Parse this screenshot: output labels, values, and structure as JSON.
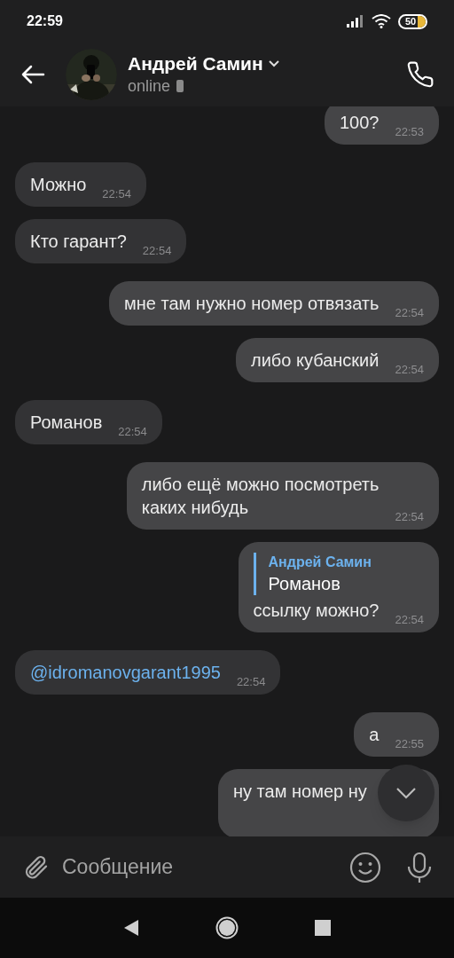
{
  "status_bar": {
    "time": "22:59",
    "battery": "50"
  },
  "header": {
    "name": "Андрей Самин",
    "status": "online"
  },
  "messages": [
    {
      "kind": "text",
      "outgoing": true,
      "text": "100?",
      "time": "22:53"
    },
    {
      "kind": "text",
      "outgoing": false,
      "text": "Можно",
      "time": "22:54"
    },
    {
      "kind": "text",
      "outgoing": false,
      "text": "Кто гарант?",
      "time": "22:54"
    },
    {
      "kind": "text",
      "outgoing": true,
      "text": "мне там нужно номер отвязать",
      "time": "22:54"
    },
    {
      "kind": "text",
      "outgoing": true,
      "text": "либо кубанский",
      "time": "22:54"
    },
    {
      "kind": "text",
      "outgoing": false,
      "text": "Романов",
      "time": "22:54"
    },
    {
      "kind": "text",
      "outgoing": true,
      "text": "либо ещё можно посмотреть\nкаких нибудь",
      "time": "22:54"
    },
    {
      "kind": "reply",
      "outgoing": true,
      "reply": {
        "author": "Андрей Самин",
        "text": "Романов"
      },
      "text": "ссылку можно?",
      "time": "22:54"
    },
    {
      "kind": "mention",
      "outgoing": false,
      "text": "@idromanovgarant1995",
      "time": "22:54"
    },
    {
      "kind": "text",
      "outgoing": true,
      "text": "а",
      "time": "22:55"
    },
    {
      "kind": "text",
      "outgoing": true,
      "text": "ну там номер ну"
    }
  ],
  "composer": {
    "placeholder": "Сообщение"
  }
}
